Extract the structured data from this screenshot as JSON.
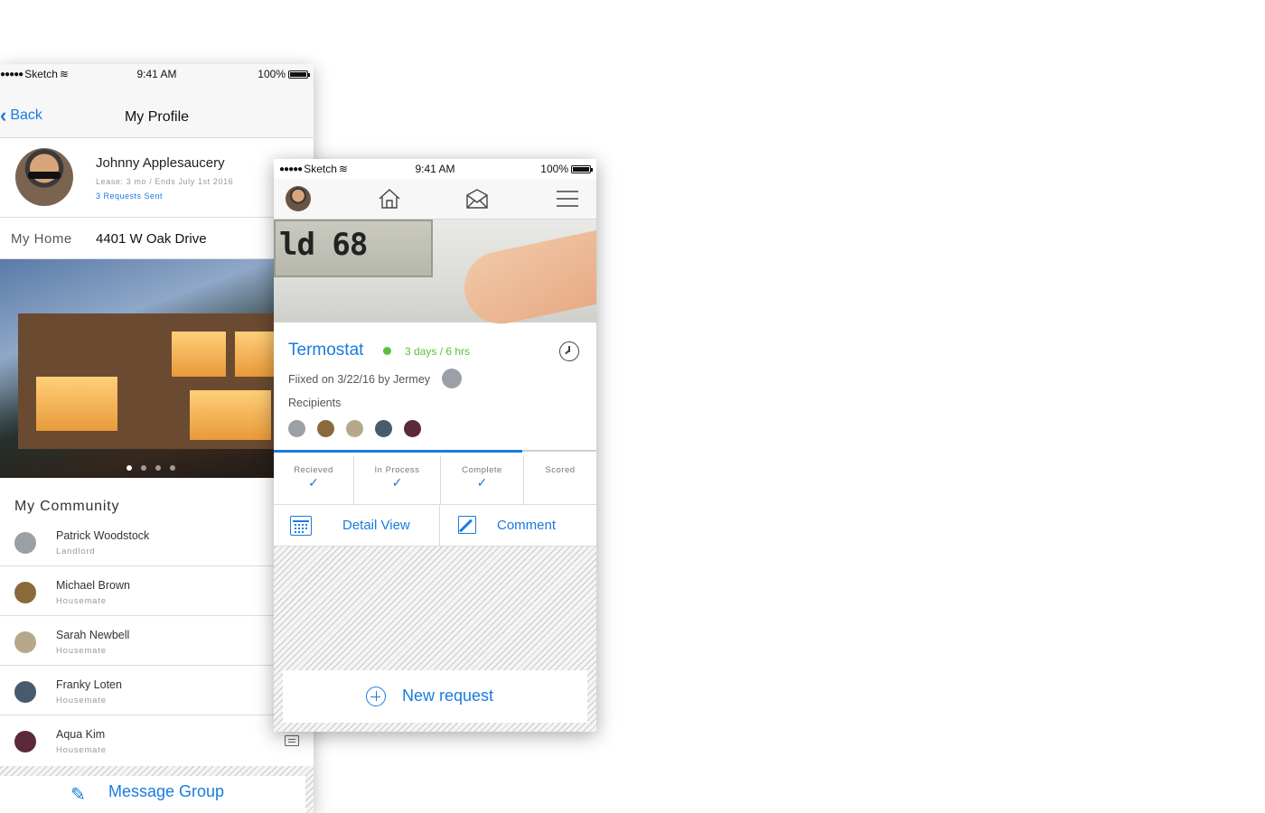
{
  "status_bar": {
    "carrier": "Sketch",
    "time": "9:41 AM",
    "battery": "100%"
  },
  "profile_screen": {
    "nav": {
      "back_label": "Back",
      "title": "My Profile"
    },
    "user": {
      "name": "Johnny Applesaucery",
      "lease": "Lease: 3 mo / Ends July 1st 2016",
      "requests": "3 Requests Sent"
    },
    "home": {
      "label": "My Home",
      "address": "4401 W Oak Drive"
    },
    "carousel": {
      "pages": 4,
      "active": 1
    },
    "community": {
      "title": "My Community",
      "members": [
        {
          "name": "Patrick Woodstock",
          "role": "Landlord",
          "color": "#9aa0a6"
        },
        {
          "name": "Michael Brown",
          "role": "Housemate",
          "color": "#8a6a3a"
        },
        {
          "name": "Sarah Newbell",
          "role": "Housemate",
          "color": "#b7a88a"
        },
        {
          "name": "Franky Loten",
          "role": "Housemate",
          "color": "#4a5a6e"
        },
        {
          "name": "Aqua Kim",
          "role": "Housemate",
          "color": "#5a2a3a"
        }
      ]
    },
    "message_group_label": "Message Group"
  },
  "request_screen": {
    "request": {
      "title": "Termostat",
      "elapsed": "3 days / 6 hrs",
      "fixed": "Fiixed on 3/22/16 by Jermey",
      "recipients_label": "Recipients",
      "recipient_colors": [
        "#9aa0a6",
        "#8a6a3a",
        "#b7a88a",
        "#4a5a6e",
        "#5a2a3a"
      ]
    },
    "thermostat_display": "ld 68",
    "progress": 0.77,
    "stages": [
      {
        "label": "Recieved",
        "done": true
      },
      {
        "label": "In Process",
        "done": true
      },
      {
        "label": "Complete",
        "done": true
      },
      {
        "label": "Scored",
        "done": false
      }
    ],
    "actions": {
      "detail_label": "Detail View",
      "comment_label": "Comment"
    },
    "new_request_label": "New request"
  },
  "colors": {
    "accent": "#1a7be0",
    "status_green": "#5ac13a"
  }
}
